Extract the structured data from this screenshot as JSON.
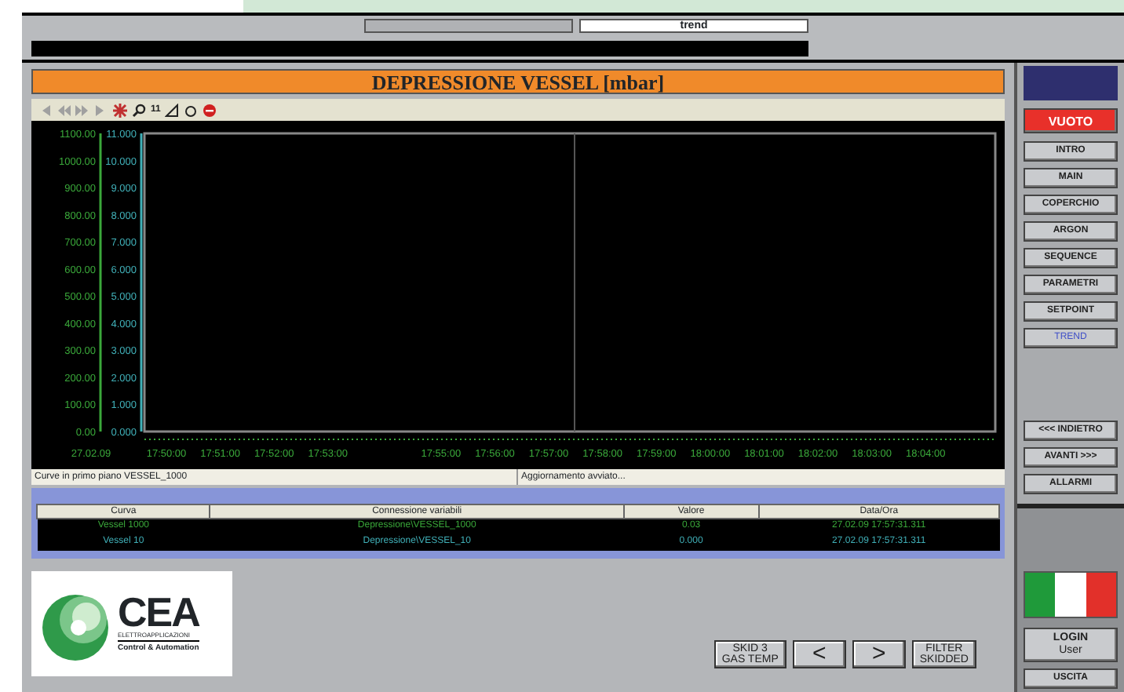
{
  "header": {
    "field_right": "trend"
  },
  "chart_title": "DEPRESSIONE VESSEL [mbar]",
  "toolbar": [
    {
      "kind": "first",
      "disabled": true
    },
    {
      "kind": "rewind",
      "disabled": true
    },
    {
      "kind": "forward",
      "disabled": true
    },
    {
      "kind": "last",
      "disabled": true
    },
    {
      "kind": "star",
      "disabled": false
    },
    {
      "kind": "zoom",
      "disabled": false
    },
    {
      "kind": "text",
      "label": "11",
      "disabled": false
    },
    {
      "kind": "triangle",
      "disabled": false
    },
    {
      "kind": "circle",
      "disabled": false
    },
    {
      "kind": "stop",
      "disabled": false
    }
  ],
  "axis_left": {
    "color": "#3aa83a",
    "labels": [
      "1100.00",
      "1000.00",
      "900.00",
      "800.00",
      "700.00",
      "600.00",
      "500.00",
      "400.00",
      "300.00",
      "200.00",
      "100.00",
      "0.00"
    ]
  },
  "axis_right": {
    "color": "#40b0b8",
    "labels": [
      "11.000",
      "10.000",
      "9.000",
      "8.000",
      "7.000",
      "6.000",
      "5.000",
      "4.000",
      "3.000",
      "2.000",
      "1.000",
      "0.000"
    ]
  },
  "x_date": "27.02.09",
  "x_labels": [
    "17:50:00",
    "17:51:00",
    "17:52:00",
    "17:53:00",
    "17:55:00",
    "17:56:00",
    "17:57:00",
    "17:58:00",
    "17:59:00",
    "18:00:00",
    "18:01:00",
    "18:02:00",
    "18:03:00",
    "18:04:00"
  ],
  "status": [
    "Curve in primo piano VESSEL_1000",
    "Aggiornamento avviato..."
  ],
  "table": {
    "columns": [
      "Curva",
      "Connessione variabili",
      "Valore",
      "Data/Ora"
    ],
    "rows": [
      {
        "cells": [
          "Vessel 1000",
          "Depressione\\VESSEL_1000",
          "0.03",
          "27.02.09 17:57:31.311"
        ]
      },
      {
        "cells": [
          "Vessel 10",
          "Depressione\\VESSEL_10",
          "0.000",
          "27.02.09 17:57:31.311"
        ]
      }
    ]
  },
  "logo": {
    "name": "CEA",
    "subtitle": "ELETTROAPPLICAZIONI",
    "tagline": "Control & Automation"
  },
  "bottom_buttons": [
    {
      "label": "SKID 3\nGAS TEMP",
      "kind": "text"
    },
    {
      "label": "<",
      "kind": "arrow"
    },
    {
      "label": ">",
      "kind": "arrow"
    },
    {
      "label": "FILTER\nSKIDDED",
      "kind": "text"
    }
  ],
  "nav": [
    {
      "label": "VUOTO",
      "kind": "alarm",
      "selected": false
    },
    {
      "label": "INTRO",
      "kind": "page",
      "selected": false
    },
    {
      "label": "MAIN",
      "kind": "page",
      "selected": false
    },
    {
      "label": "COPERCHIO",
      "kind": "page",
      "selected": false
    },
    {
      "label": "ARGON",
      "kind": "page",
      "selected": false
    },
    {
      "label": "SEQUENCE",
      "kind": "page",
      "selected": false
    },
    {
      "label": "PARAMETRI",
      "kind": "page",
      "selected": false
    },
    {
      "label": "SETPOINT",
      "kind": "page",
      "selected": false
    },
    {
      "label": "TREND",
      "kind": "page",
      "selected": true
    }
  ],
  "nav_bottom": [
    "<<< INDIETRO",
    "AVANTI >>>",
    "ALLARMI"
  ],
  "login": {
    "label": "LOGIN",
    "user": "User"
  },
  "exit": "USCITA"
}
